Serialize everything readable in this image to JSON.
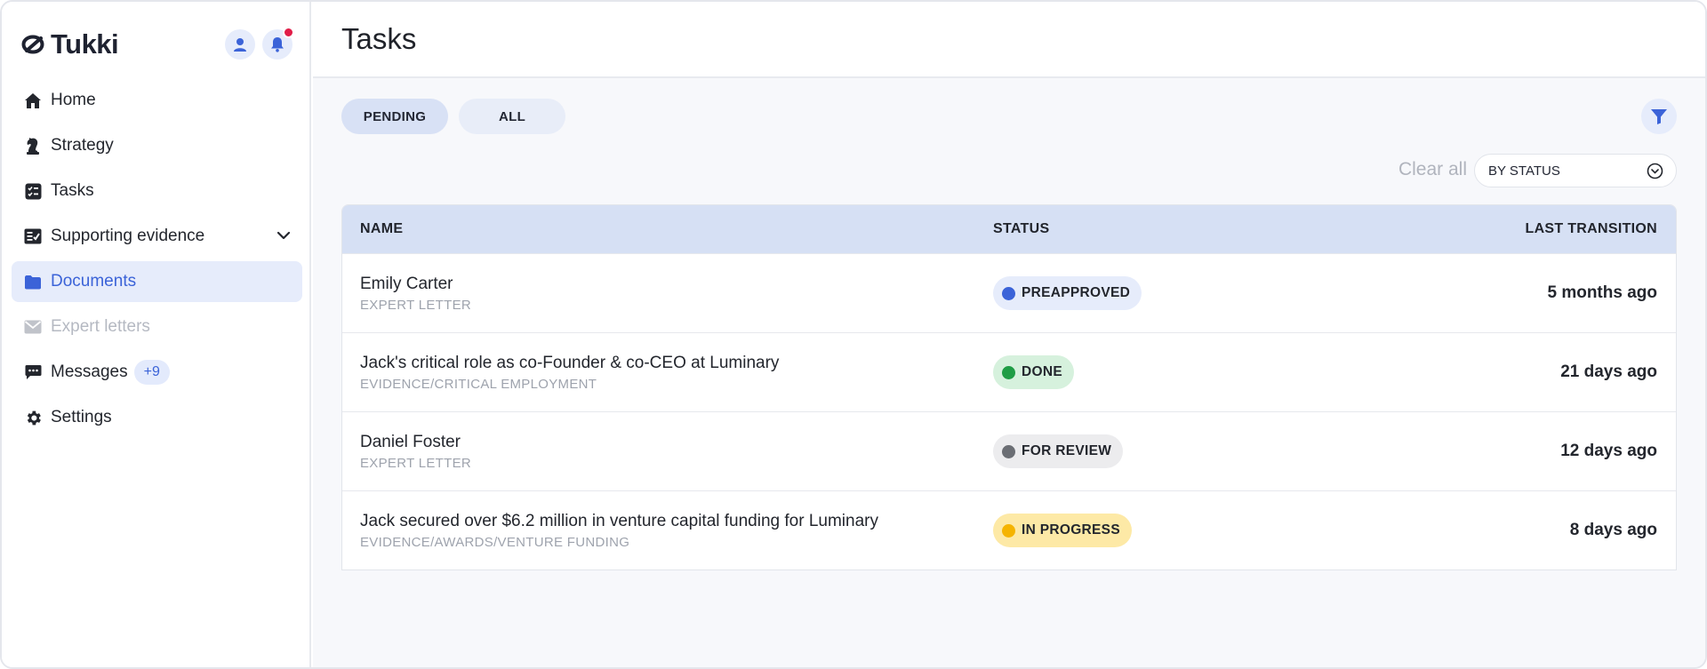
{
  "app": {
    "brand": "Tukki"
  },
  "sidebar": {
    "items": [
      {
        "label": "Home",
        "icon": "home-icon"
      },
      {
        "label": "Strategy",
        "icon": "chess-knight-icon"
      },
      {
        "label": "Tasks",
        "icon": "task-list-icon"
      },
      {
        "label": "Supporting evidence",
        "icon": "checklist-icon"
      },
      {
        "label": "Documents",
        "icon": "folder-icon",
        "active": true
      },
      {
        "label": "Expert letters",
        "icon": "envelope-icon",
        "disabled": true
      },
      {
        "label": "Messages",
        "icon": "chat-icon",
        "badge": "+9"
      },
      {
        "label": "Settings",
        "icon": "gear-icon"
      }
    ]
  },
  "header": {
    "title": "Tasks"
  },
  "tabs": [
    {
      "label": "PENDING",
      "active": true
    },
    {
      "label": "ALL",
      "active": false
    }
  ],
  "toolbar": {
    "clear_all": "Clear all",
    "group_by": "BY STATUS"
  },
  "table": {
    "columns": [
      "NAME",
      "STATUS",
      "LAST TRANSITION"
    ],
    "rows": [
      {
        "name": "Emily Carter",
        "sub": "EXPERT LETTER",
        "status": "PREAPPROVED",
        "last": "5 months ago"
      },
      {
        "name": "Jack's critical role as co-Founder & co-CEO at Luminary",
        "sub": "EVIDENCE/CRITICAL EMPLOYMENT",
        "status": "DONE",
        "last": "21 days ago"
      },
      {
        "name": "Daniel Foster",
        "sub": "EXPERT LETTER",
        "status": "FOR REVIEW",
        "last": "12 days ago"
      },
      {
        "name": "Jack secured over $6.2 million in venture capital funding for Luminary",
        "sub": "EVIDENCE/AWARDS/VENTURE FUNDING",
        "status": "IN PROGRESS",
        "last": "8 days ago"
      }
    ]
  },
  "colors": {
    "accent": "#3b63d8",
    "preapproved_bg": "#e6ecfb",
    "preapproved_dot": "#3b63d8",
    "done_bg": "#d6f1dd",
    "done_dot": "#1f9d45",
    "review_bg": "#ececee",
    "review_dot": "#6b6e74",
    "progress_bg": "#fde9a6",
    "progress_dot": "#f5b400"
  }
}
